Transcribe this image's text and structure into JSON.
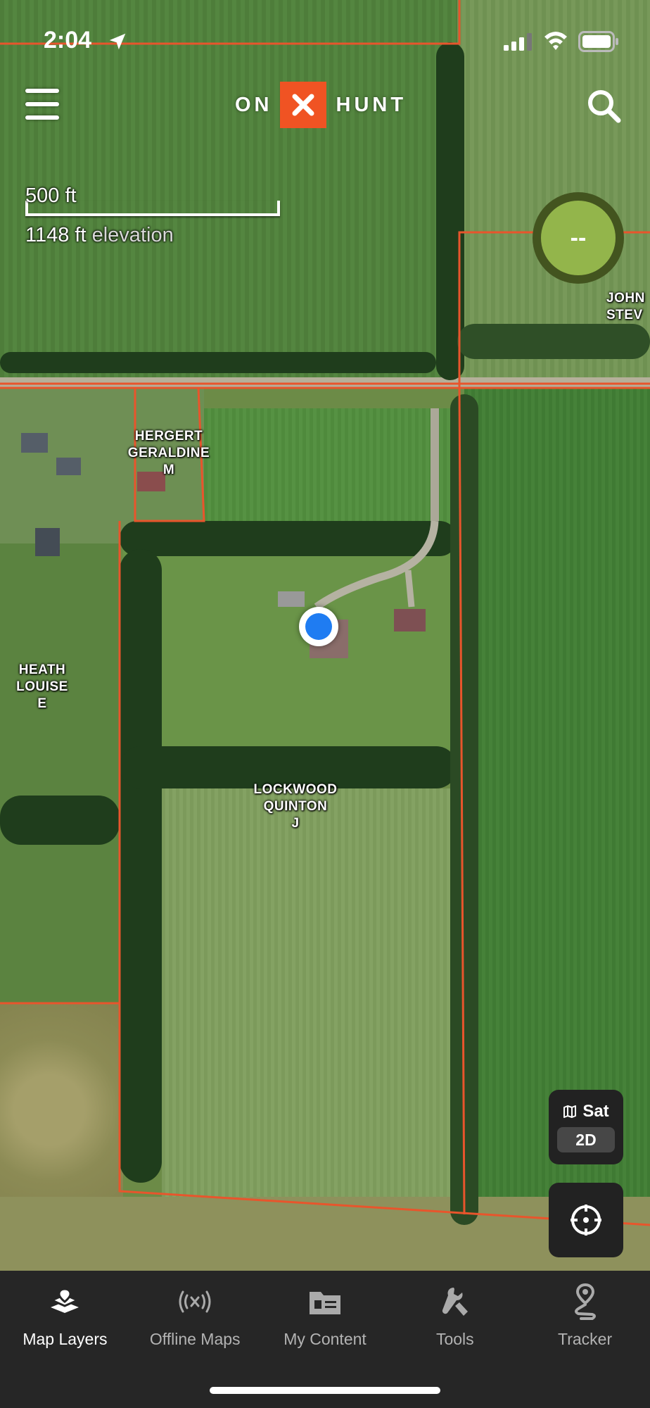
{
  "status_bar": {
    "time": "2:04",
    "icons": [
      "location-arrow-icon",
      "cellular-signal-icon",
      "wifi-icon",
      "battery-icon"
    ]
  },
  "header": {
    "logo_left": "ON",
    "logo_right": "HUNT",
    "logo_mark": "x-mark-icon",
    "menu_icon": "hamburger-menu-icon",
    "search_icon": "search-icon"
  },
  "map": {
    "scale": "500 ft",
    "elevation_value": "1148 ft",
    "elevation_word": "elevation",
    "gps_readout": "--",
    "owners": [
      "HERGERT\nGERALDINE\nM",
      "HEATH\nLOUISE\nE",
      "LOCKWOOD\nQUINTON\nJ",
      "JOHN\nSTEV"
    ],
    "parcel_line_color": "#e8552c",
    "location_color": "#1f7cf2"
  },
  "controls": {
    "basemap_label": "Sat",
    "basemap_icon": "map-icon",
    "mode": "2D",
    "compass_icon": "compass-icon"
  },
  "tabs": [
    {
      "label": "Map Layers",
      "icon": "map-layers-icon",
      "active": true
    },
    {
      "label": "Offline Maps",
      "icon": "offline-maps-icon",
      "active": false
    },
    {
      "label": "My Content",
      "icon": "my-content-icon",
      "active": false
    },
    {
      "label": "Tools",
      "icon": "tools-icon",
      "active": false
    },
    {
      "label": "Tracker",
      "icon": "tracker-icon",
      "active": false
    }
  ],
  "colors": {
    "brand_orange": "#f05323",
    "gps_green": "#93b54b",
    "tab_bar": "#262626"
  }
}
